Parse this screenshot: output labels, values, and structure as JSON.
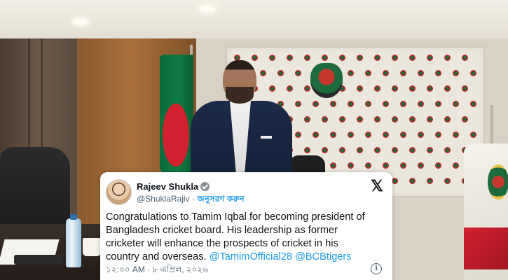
{
  "tweet": {
    "display_name": "Rajeev Shukla",
    "handle": "@ShuklaRajiv",
    "separator": "·",
    "follow_label": "অনুসরণ করুন",
    "platform_icon": "x-logo-icon",
    "text_line1": "Congratulations to Tamim Iqbal for becoming president of",
    "text_line2": "Bangladesh cricket board. His leadership as former",
    "text_line3": "cricketer will enhance the prospects of cricket in his",
    "text_line4": "country and overseas.",
    "mention1": "@TamimOfficial28",
    "mention2": "@BCBtigers",
    "time": "১২:০০ AM",
    "date": "৮ এপ্রিল, ২০২৬",
    "meta_separator": "·",
    "info_icon": "info-icon"
  },
  "colors": {
    "link": "#1d9bf0",
    "text_primary": "#0f1419",
    "text_secondary": "#536471"
  }
}
